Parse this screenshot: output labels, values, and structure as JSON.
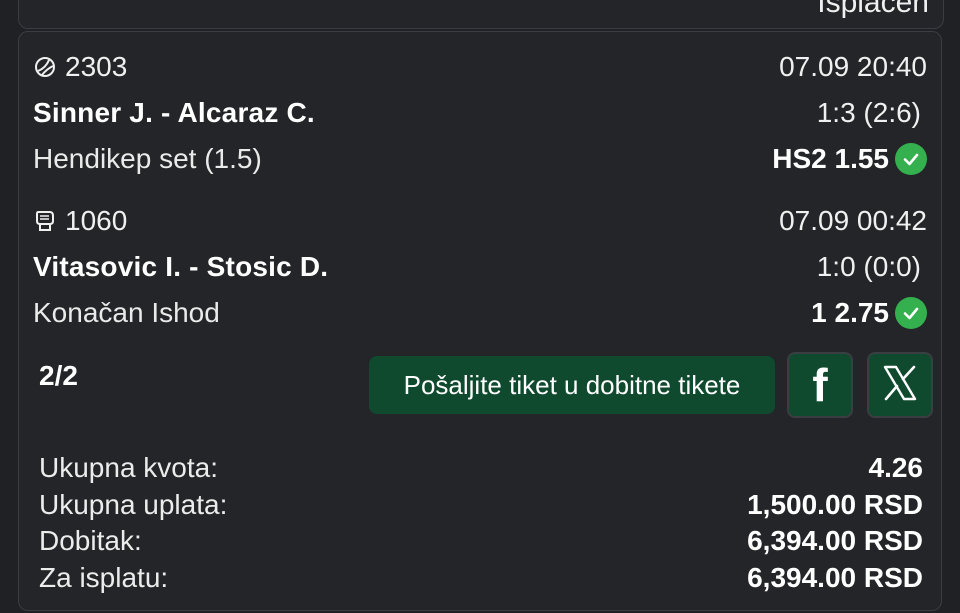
{
  "header": {
    "status": "Isplaćen"
  },
  "events": [
    {
      "sport_icon": "tennis-ball-icon",
      "code": "2303",
      "datetime": "07.09 20:40",
      "match": "Sinner J. - Alcaraz C.",
      "score": "1:3 (2:6)",
      "market": "Hendikep set (1.5)",
      "pick": "HS2 1.55",
      "status_icon": "check-icon"
    },
    {
      "sport_icon": "boxing-glove-icon",
      "code": "1060",
      "datetime": "07.09 00:42",
      "match": "Vitasovic I. - Stosic D.",
      "score": "1:0 (0:0)",
      "market": "Konačan Ishod",
      "pick": "1 2.75",
      "status_icon": "check-icon"
    }
  ],
  "ticket": {
    "count": "2/2",
    "send_label": "Pošaljite tiket u dobitne tikete",
    "facebook_glyph": "f"
  },
  "summary": [
    {
      "label": "Ukupna kvota:",
      "value": "4.26"
    },
    {
      "label": "Ukupna uplata:",
      "value": "1,500.00 RSD"
    },
    {
      "label": "Dobitak:",
      "value": "6,394.00 RSD"
    },
    {
      "label": "Za isplatu:",
      "value": "6,394.00 RSD"
    }
  ],
  "colors": {
    "background": "#1f2124",
    "card": "#232528",
    "accent_green": "#0f4a2e",
    "check_green": "#35b04f"
  }
}
